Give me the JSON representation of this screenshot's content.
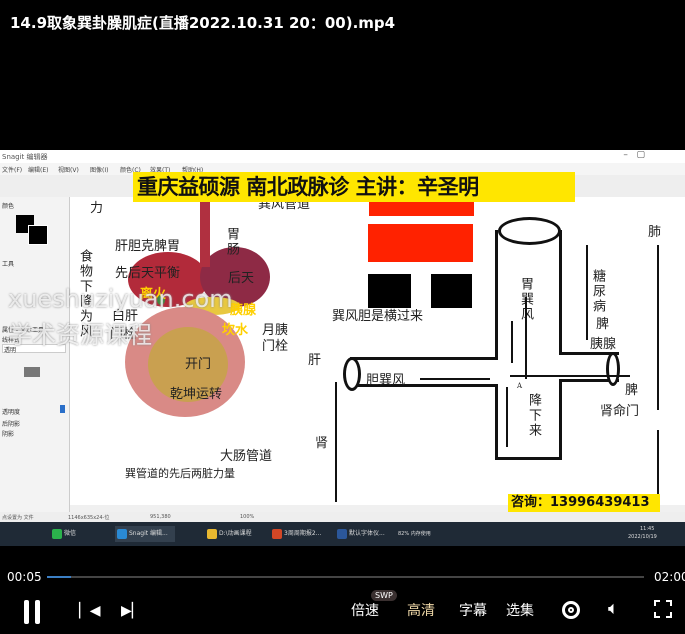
{
  "title": "14.9取象巽卦臊肌症(直播2022.10.31 20：00).mp4",
  "video": {
    "app_title": "Snagit 编辑器",
    "menu": [
      "文件(F)",
      "编辑(E)",
      "视图(V)",
      "图像(I)",
      "颜色(C)",
      "效果(T)",
      "帮助(H)"
    ],
    "banner": "重庆益硕源  南北政脉诊  主讲：辛圣明",
    "left_panel": {
      "section1": "颜色",
      "section2": "工具",
      "section3": "属性 - 文本工具",
      "style_label": "线样式",
      "style_value": "透明",
      "opacity_label": "透明度",
      "checkbox1": "后阴影",
      "checkbox2": "阴影"
    },
    "watermark1": "xueshuziyuan.com",
    "watermark2": "学术资源课程",
    "labels": {
      "l_li": "力",
      "l_gandan": "肝胆克脾胃",
      "l_xianhou": "先后天平衡",
      "l_weichang": "胃肠",
      "l_houtian": "后天",
      "l_shiwu": "食物下降为风",
      "l_xunfeng_gd": "巽风管道",
      "l_fire": "离火",
      "l_ganmenshuan": "门栓",
      "l_bai": "白肝",
      "l_yixian": "胰腺",
      "l_kanshui": "坎水",
      "l_yueyi": "月胰",
      "l_menshuan2": "门栓",
      "l_kaimen": "开门",
      "l_qiankun": "乾坤运转",
      "l_dachang": "大肠管道",
      "l_bottom": "巽管道的先后两脏力量",
      "r_weixunfeng": "胃巽风",
      "r_xunfengdan": "巽风胆是横过来",
      "r_gan": "肝",
      "r_danxunfeng": "胆巽风",
      "r_jiangxia": "降下来",
      "r_tangniao": "糖尿病",
      "r_pi": "脾",
      "r_yixian": "胰腺",
      "r_pi2": "脾",
      "r_shenmingmen": "肾命门",
      "r_fei": "肺",
      "r_shen": "肾",
      "r_a": "A"
    },
    "phone": "咨询：13996439413",
    "status": {
      "s1": "点设置为 文件",
      "s2": "1146x635x24-位",
      "s3": "951,380",
      "s4": "100%"
    },
    "taskbar": {
      "items": [
        "微信",
        "Snagit 编辑...",
        "D:\\动画课程",
        "3周周期报2...",
        "默认字体仪..."
      ],
      "sys": "82% 内存使用",
      "time": "11:45",
      "date": "2022/10/19"
    }
  },
  "player": {
    "current_time": "00:05",
    "total_time": "02:00",
    "progress_pct": 4,
    "speed": "倍速",
    "quality": "高清",
    "quality_badge": "SWP",
    "subtitle": "字幕",
    "episodes": "选集"
  },
  "colors": {
    "banner": "#ffe600",
    "trigram_red": "#ff2200",
    "progress": "#3b7fc4",
    "quality_active": "#f0d9a8"
  }
}
